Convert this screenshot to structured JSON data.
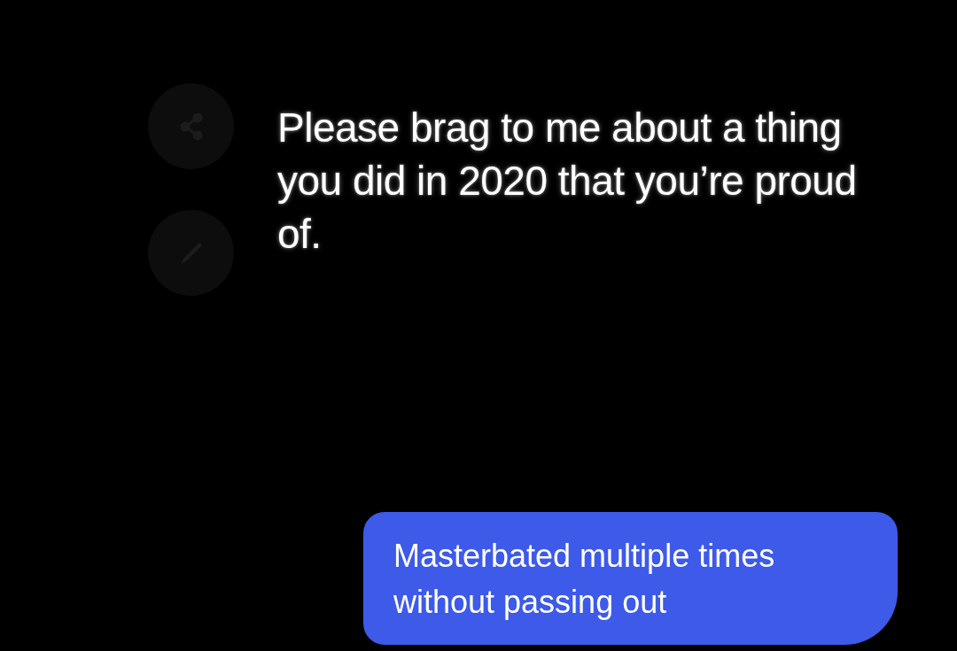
{
  "story": {
    "text": "Please brag to me about a thing you did in 2020 that you’re proud of."
  },
  "reply": {
    "text": "Masterbated multiple times without passing out"
  }
}
